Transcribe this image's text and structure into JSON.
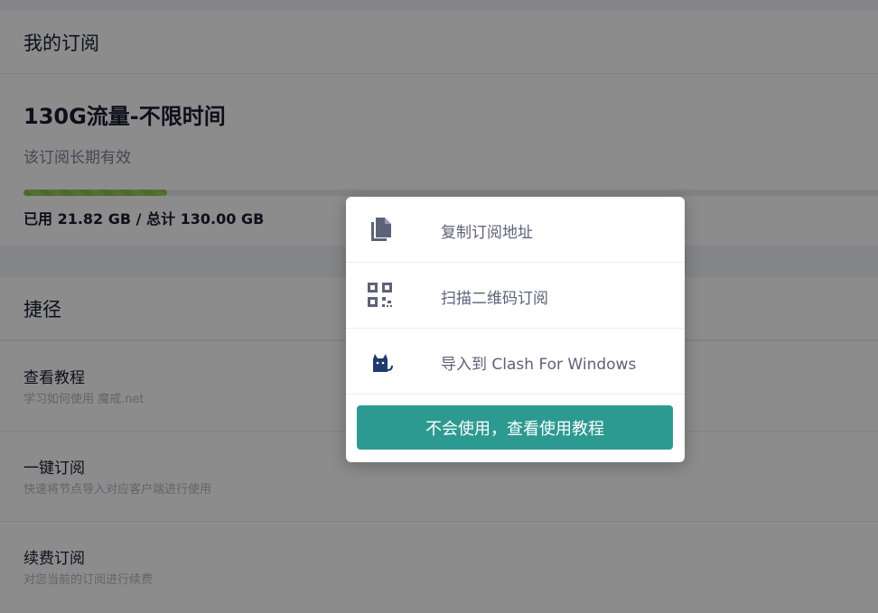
{
  "subscription": {
    "header": "我的订阅",
    "plan_name": "130G流量-不限时间",
    "validity": "该订阅长期有效",
    "usage_text": "已用 21.82 GB / 总计 130.00 GB",
    "used_gb": 21.82,
    "total_gb": 130.0
  },
  "shortcuts": {
    "header": "捷径",
    "items": [
      {
        "title": "查看教程",
        "subtitle": "学习如何使用 魔戒.net"
      },
      {
        "title": "一键订阅",
        "subtitle": "快速将节点导入对应客户端进行使用"
      },
      {
        "title": "续费订阅",
        "subtitle": "对您当前的订阅进行续费"
      }
    ]
  },
  "modal": {
    "items": [
      {
        "label": "复制订阅地址",
        "icon": "copy-icon"
      },
      {
        "label": "扫描二维码订阅",
        "icon": "qrcode-icon"
      },
      {
        "label": "导入到 Clash For Windows",
        "icon": "clash-cat-icon"
      }
    ],
    "tutorial_button": "不会使用，查看使用教程"
  },
  "colors": {
    "accent": "#2d9a92",
    "progress": "#8bc34a"
  }
}
